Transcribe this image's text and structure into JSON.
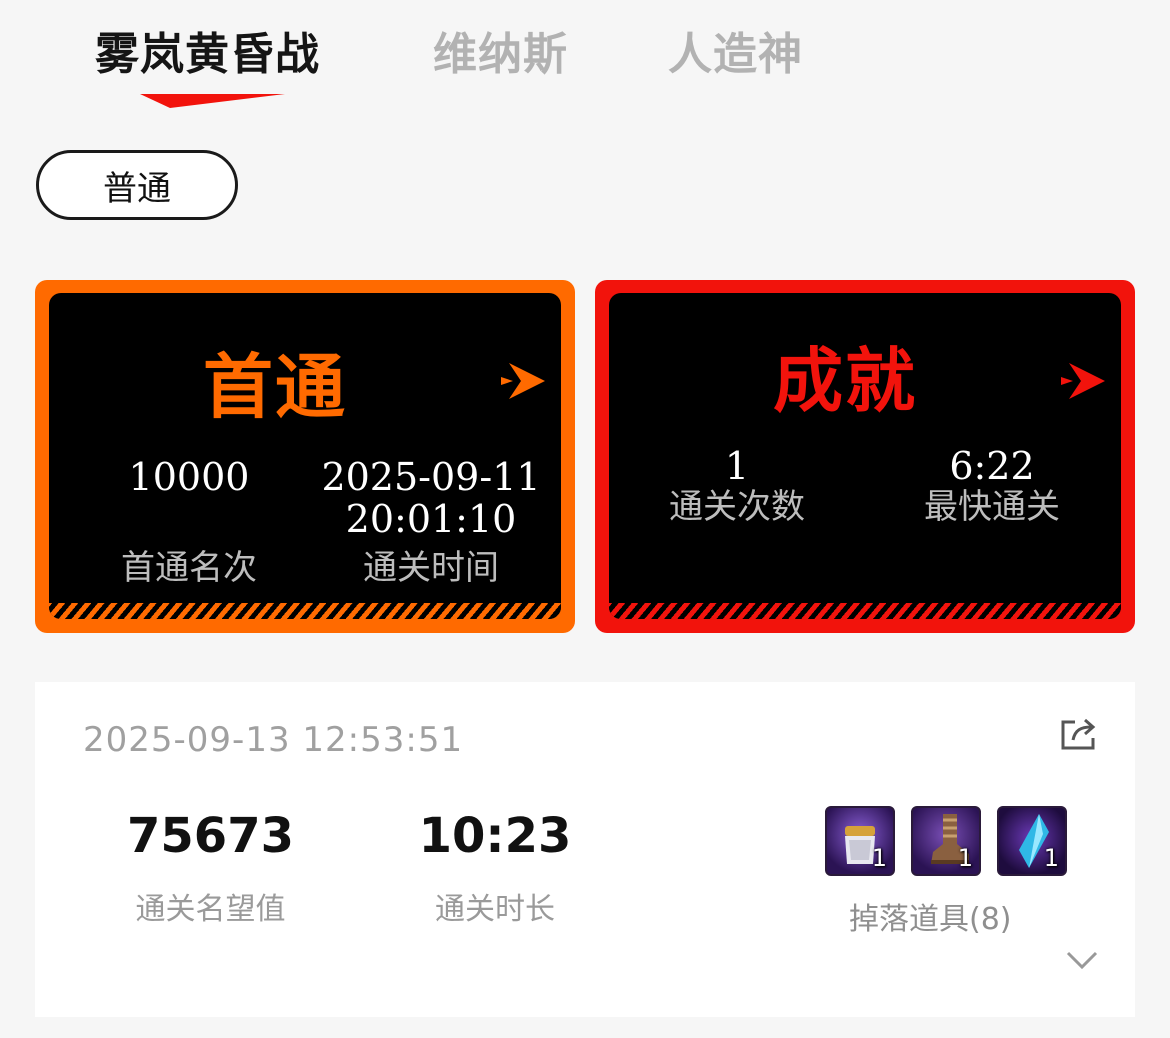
{
  "tabs": [
    {
      "label": "雾岚黄昏战",
      "active": true
    },
    {
      "label": "维纳斯",
      "active": false
    },
    {
      "label": "人造神",
      "active": false
    }
  ],
  "difficulty": {
    "label": "普通"
  },
  "first_clear": {
    "title": "首通",
    "accent": "#ff6a00",
    "rank_value": "10000",
    "rank_label": "首通名次",
    "time_date": "2025-09-11",
    "time_clock": "20:01:10",
    "time_label": "通关时间"
  },
  "achievement": {
    "title": "成就",
    "accent": "#f2130c",
    "clears_value": "1",
    "clears_label": "通关次数",
    "fastest_value": "6:22",
    "fastest_label": "最快通关"
  },
  "record": {
    "timestamp": "2025-09-13 12:53:51",
    "reputation_value": "75673",
    "reputation_label": "通关名望值",
    "duration_value": "10:23",
    "duration_label": "通关时长",
    "drops_label": "掉落道具(8)",
    "items": [
      {
        "icon": "bracer-item-icon",
        "count": "1"
      },
      {
        "icon": "boots-item-icon",
        "count": "1"
      },
      {
        "icon": "crystal-item-icon",
        "count": "1"
      }
    ]
  }
}
